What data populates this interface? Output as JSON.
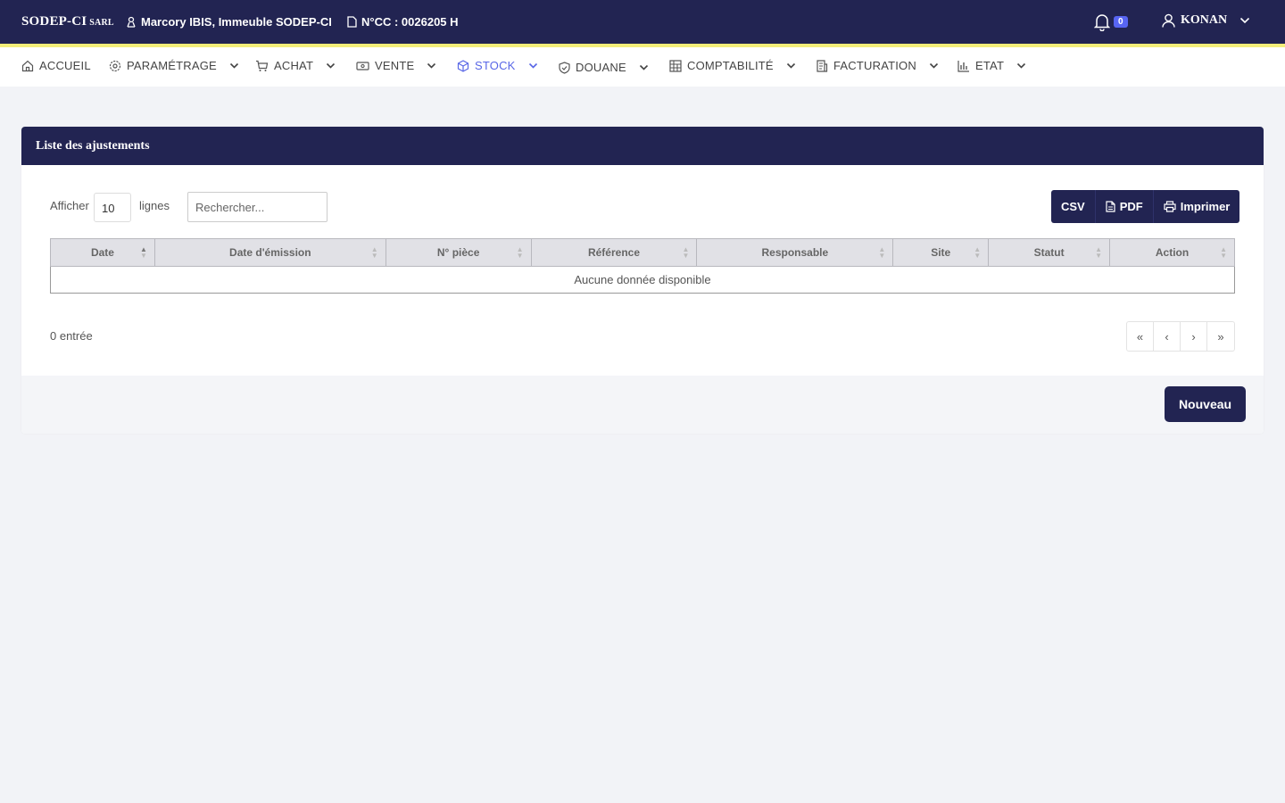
{
  "topbar": {
    "brand": "SODEP-CI",
    "brand_suffix": "SARL",
    "address": "Marcory IBIS, Immeuble SODEP-CI",
    "ncc": "N°CC : 0026205 H",
    "notifications_count": "0",
    "user_name": "KONAN"
  },
  "nav": {
    "items": [
      {
        "label": "ACCUEIL",
        "icon": "home-icon"
      },
      {
        "label": "PARAMÉTRAGE",
        "icon": "gear-icon"
      },
      {
        "label": "ACHAT",
        "icon": "cart-icon"
      },
      {
        "label": "VENTE",
        "icon": "cash-icon"
      },
      {
        "label": "STOCK",
        "icon": "box-icon",
        "active": true
      },
      {
        "label": "DOUANE",
        "icon": "shield-icon"
      },
      {
        "label": "COMPTABILITÉ",
        "icon": "grid-icon"
      },
      {
        "label": "FACTURATION",
        "icon": "invoice-icon"
      },
      {
        "label": "ETAT",
        "icon": "bar-chart-icon"
      }
    ]
  },
  "card": {
    "title": "Liste des ajustements",
    "show_label": "Afficher",
    "page_length": "10",
    "lines_label": "lignes",
    "search_placeholder": "Rechercher...",
    "export": {
      "csv": "CSV",
      "pdf": "PDF",
      "print": "Imprimer"
    },
    "columns": [
      "Date",
      "Date d'émission",
      "N° pièce",
      "Référence",
      "Responsable",
      "Site",
      "Statut",
      "Action"
    ],
    "empty_message": "Aucune donnée disponible",
    "info": "0 entrée",
    "pager": {
      "first": "«",
      "prev": "‹",
      "next": "›",
      "last": "»"
    },
    "new_button": "Nouveau"
  },
  "colors": {
    "primary": "#222452",
    "accent": "#f3ee7a",
    "active_nav": "#5866e6",
    "badge": "#5865f2"
  }
}
